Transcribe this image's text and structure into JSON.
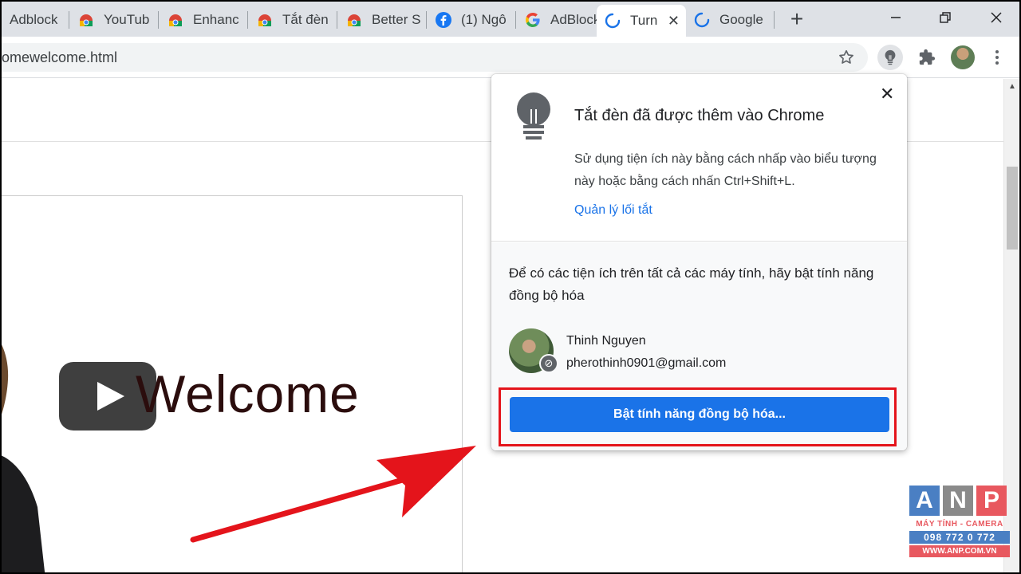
{
  "tabs": [
    {
      "title": "Adblock",
      "favicon": "partial-icon"
    },
    {
      "title": "YouTub",
      "favicon": "chrome-web-store-icon"
    },
    {
      "title": "Enhanc",
      "favicon": "chrome-web-store-icon"
    },
    {
      "title": "Tắt đèn",
      "favicon": "chrome-web-store-icon"
    },
    {
      "title": "Better S",
      "favicon": "chrome-web-store-icon"
    },
    {
      "title": "(1) Ngô",
      "favicon": "facebook-icon"
    },
    {
      "title": "AdBlock",
      "favicon": "google-icon"
    },
    {
      "title": "Turn",
      "favicon": "loading-spinner-icon",
      "active": true
    },
    {
      "title": "Google",
      "favicon": "loading-spinner-icon"
    }
  ],
  "toolbar": {
    "url": "omewelcome.html"
  },
  "page": {
    "welcome_text": "Welcome"
  },
  "popup": {
    "title": "Tắt đèn đã được thêm vào Chrome",
    "description": "Sử dụng tiện ích này bằng cách nhấp vào biểu tượng này hoặc bằng cách nhấn Ctrl+Shift+L.",
    "manage_link": "Quản lý lối tắt",
    "sync_prompt": "Để có các tiện ích trên tất cả các máy tính, hãy bật tính năng đồng bộ hóa",
    "user_name": "Thinh Nguyen",
    "user_email": "pherothinh0901@gmail.com",
    "sync_button": "Bật tính năng đồng bộ hóa..."
  },
  "watermark": {
    "letters": [
      "A",
      "N",
      "P"
    ],
    "tagline": "MÁY TÍNH - CAMERA",
    "phone": "098 772 0 772",
    "website": "WWW.ANP.COM.VN"
  },
  "colors": {
    "accent": "#1a73e8",
    "highlight": "#e4141b",
    "tabstrip": "#dee1e6"
  }
}
